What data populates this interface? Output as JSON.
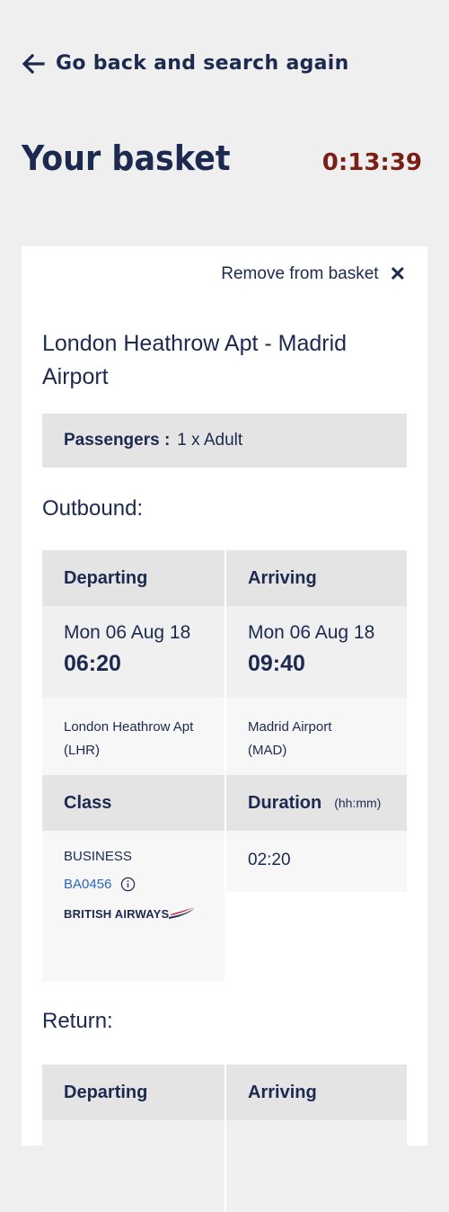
{
  "header": {
    "back_label": "Go back and search again",
    "title": "Your basket",
    "timer": "0:13:39"
  },
  "basket": {
    "remove_label": "Remove from basket",
    "route": "London Heathrow Apt - Madrid Airport",
    "passengers_label": "Passengers :",
    "passengers_value": "1 x Adult",
    "outbound": {
      "label": "Outbound:",
      "departing_header": "Departing",
      "arriving_header": "Arriving",
      "depart_date": "Mon 06 Aug 18",
      "depart_time": "06:20",
      "arrive_date": "Mon 06 Aug 18",
      "arrive_time": "09:40",
      "depart_airport_name": "London Heathrow Apt",
      "depart_airport_code": "(LHR)",
      "arrive_airport_name": "Madrid Airport",
      "arrive_airport_code": "(MAD)",
      "class_header": "Class",
      "duration_header": "Duration",
      "duration_unit": "(hh:mm)",
      "class_value": "BUSINESS",
      "flight_number": "BA0456",
      "airline_logo_text": "BRITISH AIRWAYS",
      "duration_value": "02:20"
    },
    "return": {
      "label": "Return:",
      "departing_header": "Departing",
      "arriving_header": "Arriving"
    }
  },
  "colors": {
    "navy": "#1d2a4f",
    "timer_red": "#7a1f15",
    "link_blue": "#2a66b4",
    "page_bg": "#efefef"
  },
  "icons": [
    "arrow-left-icon",
    "close-icon",
    "info-icon",
    "british-airways-logo"
  ]
}
